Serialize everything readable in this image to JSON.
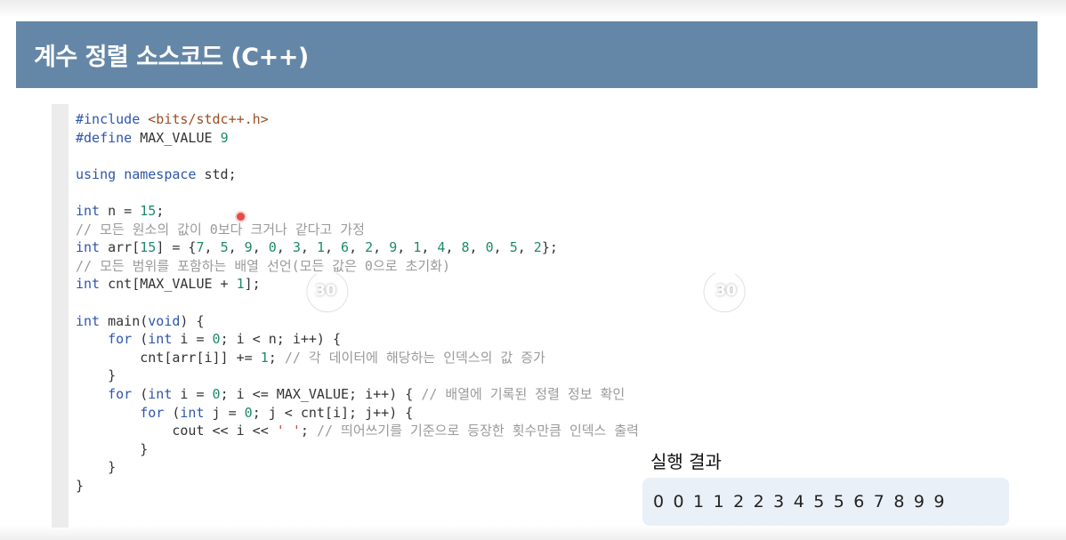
{
  "slide": {
    "title": "계수 정렬 소스코드 (C++)",
    "title_bar_color": "#6587a7"
  },
  "code_lines": [
    [
      {
        "t": "#include ",
        "c": "pp"
      },
      {
        "t": "<bits/stdc++.h>",
        "c": "inc"
      }
    ],
    [
      {
        "t": "#define ",
        "c": "pp"
      },
      {
        "t": "MAX_VALUE ",
        "c": ""
      },
      {
        "t": "9",
        "c": "num"
      }
    ],
    [],
    [
      {
        "t": "using",
        "c": "kw"
      },
      {
        "t": " ",
        "c": ""
      },
      {
        "t": "namespace",
        "c": "kw"
      },
      {
        "t": " std;",
        "c": ""
      }
    ],
    [],
    [
      {
        "t": "int",
        "c": "kw"
      },
      {
        "t": " n = ",
        "c": ""
      },
      {
        "t": "15",
        "c": "num"
      },
      {
        "t": ";",
        "c": ""
      }
    ],
    [
      {
        "t": "// 모든 원소의 값이 0보다 크거나 같다고 가정",
        "c": "cmt"
      }
    ],
    [
      {
        "t": "int",
        "c": "kw"
      },
      {
        "t": " arr[",
        "c": ""
      },
      {
        "t": "15",
        "c": "num"
      },
      {
        "t": "] = {",
        "c": ""
      },
      {
        "t": "7",
        "c": "num"
      },
      {
        "t": ", ",
        "c": ""
      },
      {
        "t": "5",
        "c": "num"
      },
      {
        "t": ", ",
        "c": ""
      },
      {
        "t": "9",
        "c": "num"
      },
      {
        "t": ", ",
        "c": ""
      },
      {
        "t": "0",
        "c": "num"
      },
      {
        "t": ", ",
        "c": ""
      },
      {
        "t": "3",
        "c": "num"
      },
      {
        "t": ", ",
        "c": ""
      },
      {
        "t": "1",
        "c": "num"
      },
      {
        "t": ", ",
        "c": ""
      },
      {
        "t": "6",
        "c": "num"
      },
      {
        "t": ", ",
        "c": ""
      },
      {
        "t": "2",
        "c": "num"
      },
      {
        "t": ", ",
        "c": ""
      },
      {
        "t": "9",
        "c": "num"
      },
      {
        "t": ", ",
        "c": ""
      },
      {
        "t": "1",
        "c": "num"
      },
      {
        "t": ", ",
        "c": ""
      },
      {
        "t": "4",
        "c": "num"
      },
      {
        "t": ", ",
        "c": ""
      },
      {
        "t": "8",
        "c": "num"
      },
      {
        "t": ", ",
        "c": ""
      },
      {
        "t": "0",
        "c": "num"
      },
      {
        "t": ", ",
        "c": ""
      },
      {
        "t": "5",
        "c": "num"
      },
      {
        "t": ", ",
        "c": ""
      },
      {
        "t": "2",
        "c": "num"
      },
      {
        "t": "};",
        "c": ""
      }
    ],
    [
      {
        "t": "// 모든 범위를 포함하는 배열 선언(모든 값은 0으로 초기화)",
        "c": "cmt"
      }
    ],
    [
      {
        "t": "int",
        "c": "kw"
      },
      {
        "t": " cnt[MAX_VALUE + ",
        "c": ""
      },
      {
        "t": "1",
        "c": "num"
      },
      {
        "t": "];",
        "c": ""
      }
    ],
    [],
    [
      {
        "t": "int",
        "c": "kw"
      },
      {
        "t": " main(",
        "c": ""
      },
      {
        "t": "void",
        "c": "kw"
      },
      {
        "t": ") {",
        "c": ""
      }
    ],
    [
      {
        "t": "    ",
        "c": ""
      },
      {
        "t": "for",
        "c": "kw"
      },
      {
        "t": " (",
        "c": ""
      },
      {
        "t": "int",
        "c": "kw"
      },
      {
        "t": " i = ",
        "c": ""
      },
      {
        "t": "0",
        "c": "num"
      },
      {
        "t": "; i < n; i++) {",
        "c": ""
      }
    ],
    [
      {
        "t": "        cnt[arr[i]] += ",
        "c": ""
      },
      {
        "t": "1",
        "c": "num"
      },
      {
        "t": "; ",
        "c": ""
      },
      {
        "t": "// 각 데이터에 해당하는 인덱스의 값 증가",
        "c": "cmt"
      }
    ],
    [
      {
        "t": "    }",
        "c": ""
      }
    ],
    [
      {
        "t": "    ",
        "c": ""
      },
      {
        "t": "for",
        "c": "kw"
      },
      {
        "t": " (",
        "c": ""
      },
      {
        "t": "int",
        "c": "kw"
      },
      {
        "t": " i = ",
        "c": ""
      },
      {
        "t": "0",
        "c": "num"
      },
      {
        "t": "; i <= MAX_VALUE; i++) { ",
        "c": ""
      },
      {
        "t": "// 배열에 기록된 정렬 정보 확인",
        "c": "cmt"
      }
    ],
    [
      {
        "t": "        ",
        "c": ""
      },
      {
        "t": "for",
        "c": "kw"
      },
      {
        "t": " (",
        "c": ""
      },
      {
        "t": "int",
        "c": "kw"
      },
      {
        "t": " j = ",
        "c": ""
      },
      {
        "t": "0",
        "c": "num"
      },
      {
        "t": "; j < cnt[i]; j++) {",
        "c": ""
      }
    ],
    [
      {
        "t": "            cout << i << ",
        "c": ""
      },
      {
        "t": "' '",
        "c": "str"
      },
      {
        "t": "; ",
        "c": ""
      },
      {
        "t": "// 띄어쓰기를 기준으로 등장한 횟수만큼 인덱스 출력",
        "c": "cmt"
      }
    ],
    [
      {
        "t": "        }",
        "c": ""
      }
    ],
    [
      {
        "t": "    }",
        "c": ""
      }
    ],
    [
      {
        "t": "}",
        "c": ""
      }
    ]
  ],
  "player": {
    "rewind_icon": "rewind-30-icon",
    "rewind_label": "30",
    "forward_icon": "forward-30-icon",
    "forward_label": "30"
  },
  "result": {
    "title": "실행 결과",
    "output": "0 0 1 1 2 2 3 4 5 5 6 7 8 9 9"
  }
}
